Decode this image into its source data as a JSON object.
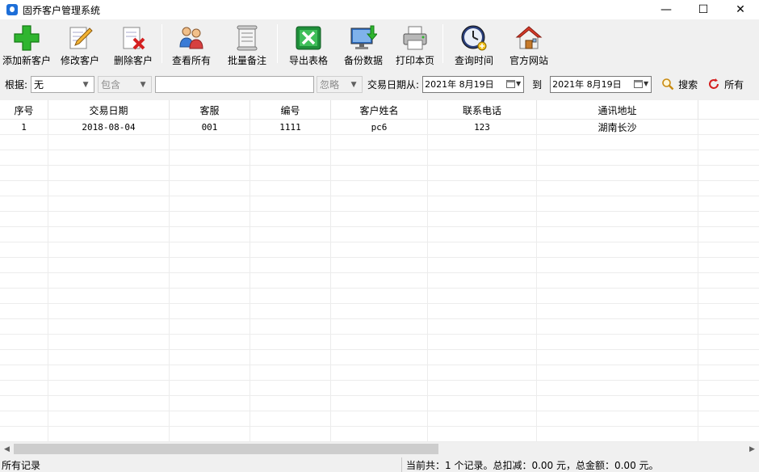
{
  "window": {
    "title": "固乔客户管理系统",
    "minimize": "—",
    "maximize": "☐",
    "close": "✕"
  },
  "toolbar": {
    "add": "添加新客户",
    "edit": "修改客户",
    "delete": "删除客户",
    "view_all": "查看所有",
    "batch_note": "批量备注",
    "export": "导出表格",
    "backup": "备份数据",
    "print": "打印本页",
    "query_time": "查询时间",
    "website": "官方网站"
  },
  "filter": {
    "basis_label": "根据:",
    "basis_value": "无",
    "match_value": "包含",
    "search_text": "",
    "case_value": "忽略",
    "date_from_label": "交易日期从:",
    "date_from": "2021年 8月19日",
    "to_label": "到",
    "date_to": "2021年 8月19日",
    "search_btn": "搜索",
    "all_btn": "所有"
  },
  "table": {
    "columns": [
      "序号",
      "交易日期",
      "客服",
      "编号",
      "客户姓名",
      "联系电话",
      "通讯地址"
    ],
    "rows": [
      [
        "1",
        "2018-08-04",
        "001",
        "1111",
        "pc6",
        "123",
        "湖南长沙"
      ]
    ]
  },
  "status": {
    "left": "所有记录",
    "right": "当前共：1 个记录。总扣减：0.00 元，总金额：0.00 元。"
  }
}
